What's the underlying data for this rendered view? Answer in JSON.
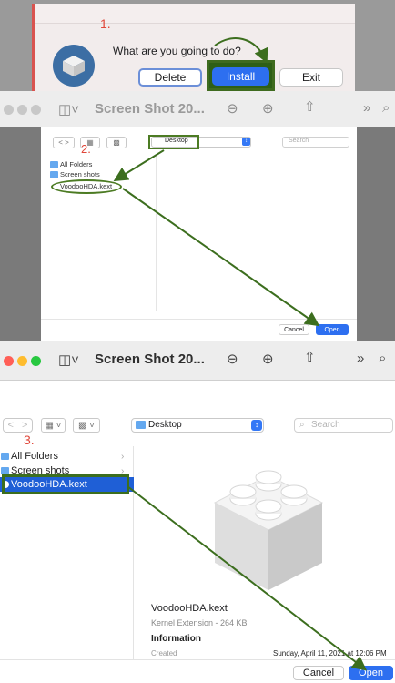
{
  "panel1": {
    "step": "1.",
    "question": "What are you going to do?",
    "buttons": {
      "delete": "Delete",
      "install": "Install",
      "exit": "Exit"
    },
    "app_icon": "lego-brick-icon"
  },
  "panel2": {
    "window_title": "Screen Shot 20...",
    "toolbar_icons": [
      "sidebar-icon",
      "zoom-out-icon",
      "zoom-in-icon",
      "share-icon",
      "more-icon"
    ],
    "step": "2.",
    "path": "Desktop",
    "search_placeholder": "Search",
    "sidebar": [
      "All Folders",
      "Screen shots",
      "VoodooHDA.kext"
    ],
    "buttons": {
      "cancel": "Cancel",
      "open": "Open"
    }
  },
  "panel3": {
    "window_title": "Screen Shot 20...",
    "toolbar_icons": [
      "sidebar-icon",
      "zoom-out-icon",
      "zoom-in-icon",
      "share-icon",
      "more-icon",
      "search-icon"
    ]
  },
  "panel4": {
    "step": "3.",
    "path": "Desktop",
    "search_placeholder": "Search",
    "sidebar": [
      "All Folders",
      "Screen shots",
      "VoodooHDA.kext"
    ],
    "preview": {
      "name": "VoodooHDA.kext",
      "kind": "Kernel Extension - 264 KB",
      "info_heading": "Information",
      "created_label": "Created",
      "created_value": "Sunday, April 11, 2021 at 12:06 PM"
    },
    "buttons": {
      "cancel": "Cancel",
      "open": "Open"
    }
  },
  "colors": {
    "accent_blue": "#2d6ff0",
    "annotation_green": "#3c6e1e",
    "step_red": "#e0473a"
  }
}
